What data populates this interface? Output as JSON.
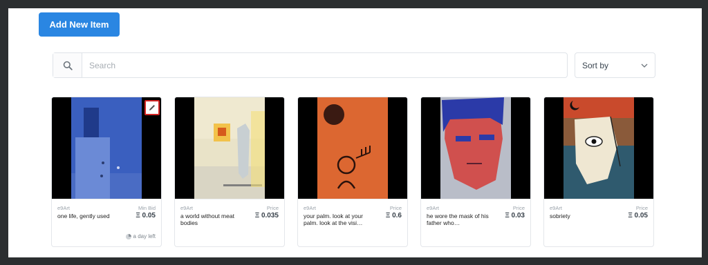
{
  "toolbar": {
    "add_label": "Add New Item"
  },
  "search": {
    "placeholder": "Search",
    "value": ""
  },
  "sort": {
    "label": "Sort by"
  },
  "cards": [
    {
      "creator": "e9Art",
      "price_label": "Min Bid",
      "title": "one life, gently used",
      "price": "Ξ 0.05",
      "time_left": "a day left"
    },
    {
      "creator": "e9Art",
      "price_label": "Price",
      "title": "a world without meat bodies",
      "price": "Ξ 0.035"
    },
    {
      "creator": "e9Art",
      "price_label": "Price",
      "title": "your palm. look at your palm. look at the visi…",
      "price": "Ξ 0.6"
    },
    {
      "creator": "e9Art",
      "price_label": "Price",
      "title": "he wore the mask of his father who…",
      "price": "Ξ 0.03"
    },
    {
      "creator": "e9Art",
      "price_label": "Price",
      "title": "sobriety",
      "price": "Ξ 0.05"
    }
  ],
  "colors": {
    "accent": "#2a86e2",
    "edit_border": "#d32525"
  },
  "icons": {
    "search": "search-icon",
    "sort": "chevron-down-icon",
    "edit": "pencil-icon",
    "time": "clock-icon"
  }
}
